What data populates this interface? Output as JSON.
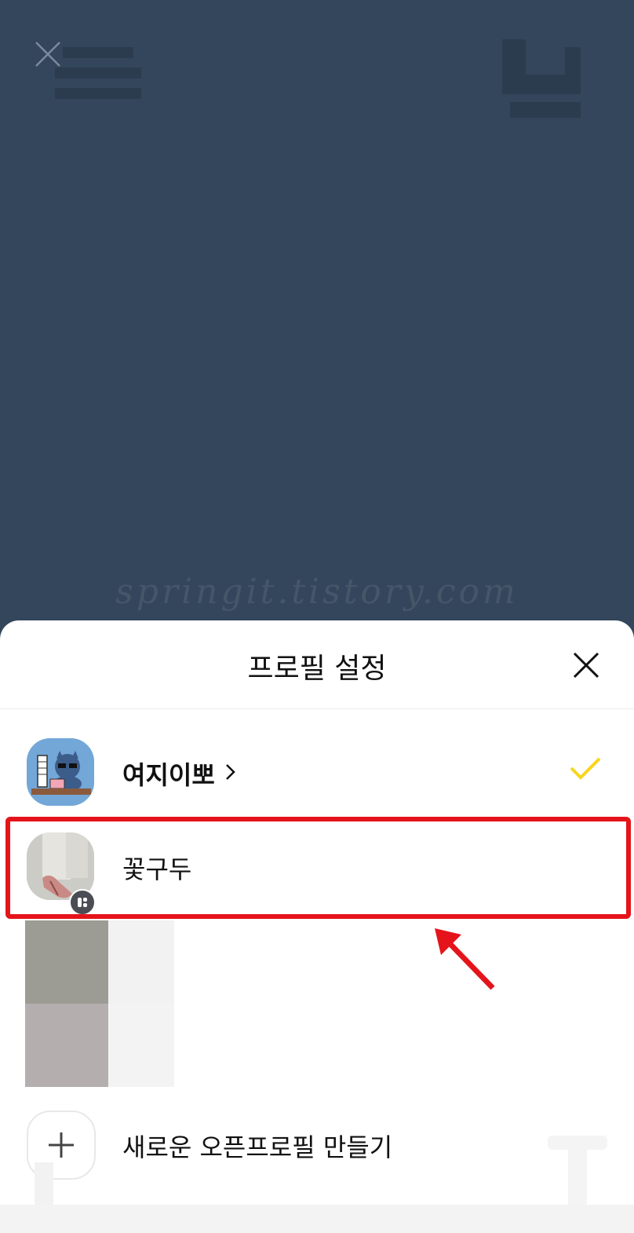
{
  "background": {
    "color": "#34465b",
    "close_icon": "close-icon",
    "watermark": "springit.tistory.com"
  },
  "sheet": {
    "title": "프로필 설정",
    "close_icon": "close-icon"
  },
  "profiles": [
    {
      "name": "여지이뽀",
      "chevron": "›",
      "selected": true,
      "icon": "avatar-character-icon",
      "check_color": "#f7d51d"
    },
    {
      "name": "꽃구두",
      "selected": false,
      "icon": "open-profile-badge-icon",
      "highlighted": true,
      "highlight_color": "#e5141b"
    }
  ],
  "new_profile": {
    "label": "새로운 오픈프로필 만들기",
    "icon": "plus-icon"
  }
}
